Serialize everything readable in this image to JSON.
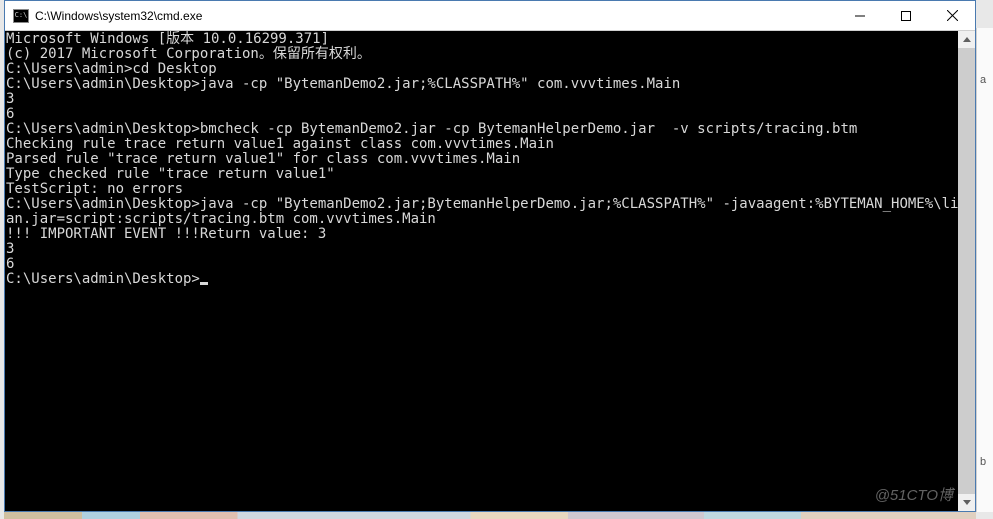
{
  "window": {
    "title": "C:\\Windows\\system32\\cmd.exe"
  },
  "terminal": {
    "lines": [
      "Microsoft Windows [版本 10.0.16299.371]",
      "(c) 2017 Microsoft Corporation。保留所有权利。",
      "",
      "C:\\Users\\admin>cd Desktop",
      "",
      "C:\\Users\\admin\\Desktop>java -cp \"BytemanDemo2.jar;%CLASSPATH%\" com.vvvtimes.Main",
      "3",
      "6",
      "",
      "C:\\Users\\admin\\Desktop>bmcheck -cp BytemanDemo2.jar -cp BytemanHelperDemo.jar  -v scripts/tracing.btm",
      "Checking rule trace return value1 against class com.vvvtimes.Main",
      "Parsed rule \"trace return value1\" for class com.vvvtimes.Main",
      "Type checked rule \"trace return value1\"",
      "",
      "TestScript: no errors",
      "",
      "C:\\Users\\admin\\Desktop>java -cp \"BytemanDemo2.jar;BytemanHelperDemo.jar;%CLASSPATH%\" -javaagent:%BYTEMAN_HOME%\\lib\\bytem",
      "an.jar=script:scripts/tracing.btm com.vvvtimes.Main",
      "!!! IMPORTANT EVENT !!!Return value: 3",
      "3",
      "6",
      "",
      "C:\\Users\\admin\\Desktop>"
    ]
  },
  "watermark": "@51CTO博",
  "edge": {
    "a": "a",
    "b": "b"
  }
}
